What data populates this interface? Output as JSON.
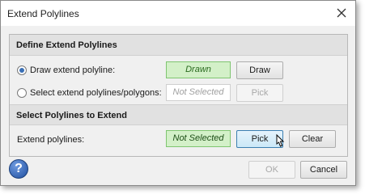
{
  "window": {
    "title": "Extend Polylines"
  },
  "section1": {
    "header": "Define Extend Polylines",
    "rows": [
      {
        "label": "Draw extend polyline:",
        "selected": true,
        "status": "Drawn",
        "button": "Draw",
        "button_enabled": true
      },
      {
        "label": "Select extend polylines/polygons:",
        "selected": false,
        "status": "Not Selected",
        "button": "Pick",
        "button_enabled": false
      }
    ]
  },
  "section2": {
    "header": "Select Polylines to Extend",
    "row": {
      "label": "Extend polylines:",
      "status": "Not Selected",
      "pick": "Pick",
      "clear": "Clear"
    }
  },
  "footer": {
    "ok": "OK",
    "cancel": "Cancel",
    "help_icon": "question-icon",
    "ok_enabled": false
  }
}
